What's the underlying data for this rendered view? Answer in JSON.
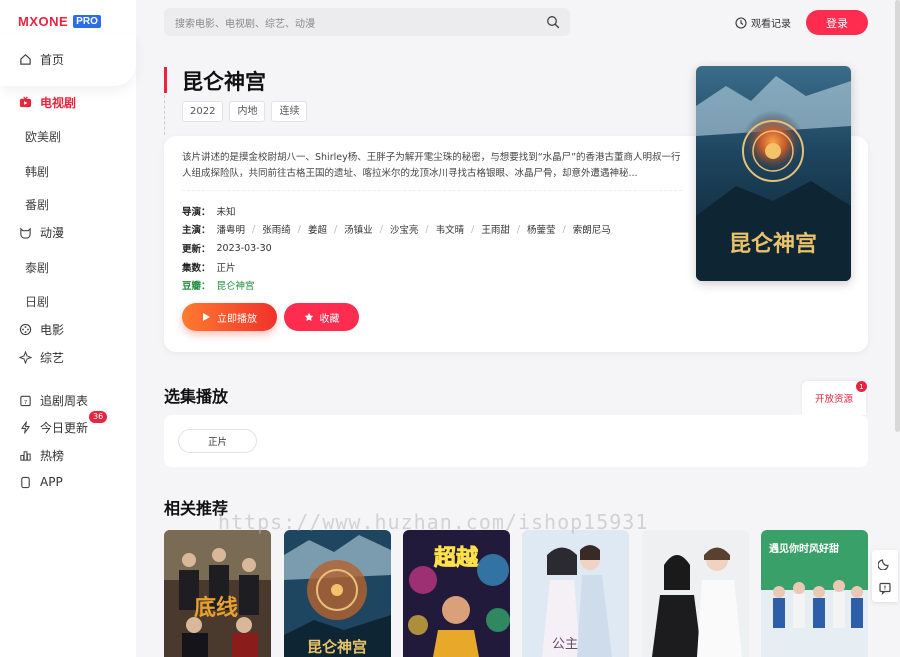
{
  "logo": {
    "text": "MXONE",
    "badge": "PRO"
  },
  "sidebar": {
    "home": "首页",
    "tv": "电视剧",
    "tv_subs": [
      "欧美剧",
      "韩剧",
      "番剧"
    ],
    "anime": "动漫",
    "anime_subs": [
      "泰剧",
      "日剧"
    ],
    "movie": "电影",
    "variety": "综艺",
    "weekly": "追剧周表",
    "today": "今日更新",
    "today_count": "36",
    "hot": "热榜",
    "app": "APP"
  },
  "header": {
    "search_placeholder": "搜索电影、电视剧、综艺、动漫",
    "history": "观看记录",
    "login": "登录"
  },
  "detail": {
    "title": "昆仑神宫",
    "tags": [
      "2022",
      "内地",
      "连续"
    ],
    "description": "该片讲述的是摸金校尉胡八一、Shirley杨、王胖子为解开雮尘珠的秘密，与想要找到“水晶尸”的香港古董商人明叔一行人组成探险队，共同前往古格王国的遗址、喀拉米尔的龙顶冰川寻找古格银眼、冰晶尸骨，却意外遭遇神秘...",
    "director_label": "导演：",
    "director": "未知",
    "cast_label": "主演：",
    "cast": [
      "潘粤明",
      "张雨绮",
      "姜超",
      "汤镇业",
      "沙宝亮",
      "韦文晴",
      "王雨甜",
      "杨蓥莹",
      "索朗尼马"
    ],
    "updated_label": "更新：",
    "updated": "2023-03-30",
    "episodes_label": "集数：",
    "episodes": "正片",
    "douban_label": "豆瓣：",
    "douban": "昆仑神宫",
    "play_button": "立即播放",
    "fav_button": "收藏",
    "poster_text": "昆仑神宫"
  },
  "episodes_section": {
    "title": "选集播放",
    "source_tab": "开放资源",
    "source_badge": "1",
    "items": [
      "正片"
    ]
  },
  "related": {
    "title": "相关推荐",
    "cards": [
      {
        "text": "底线"
      },
      {
        "text": "昆仑神宫"
      },
      {
        "text": "超越"
      },
      {
        "text": "公主"
      },
      {
        "text": ""
      },
      {
        "text": "遇见你时风好甜"
      }
    ]
  },
  "watermark": "https://www.huzhan.com/ishop15931",
  "colors": {
    "accent": "#fe2d50",
    "green": "#1d8c3a",
    "logo_badge": "#2b6de8"
  }
}
